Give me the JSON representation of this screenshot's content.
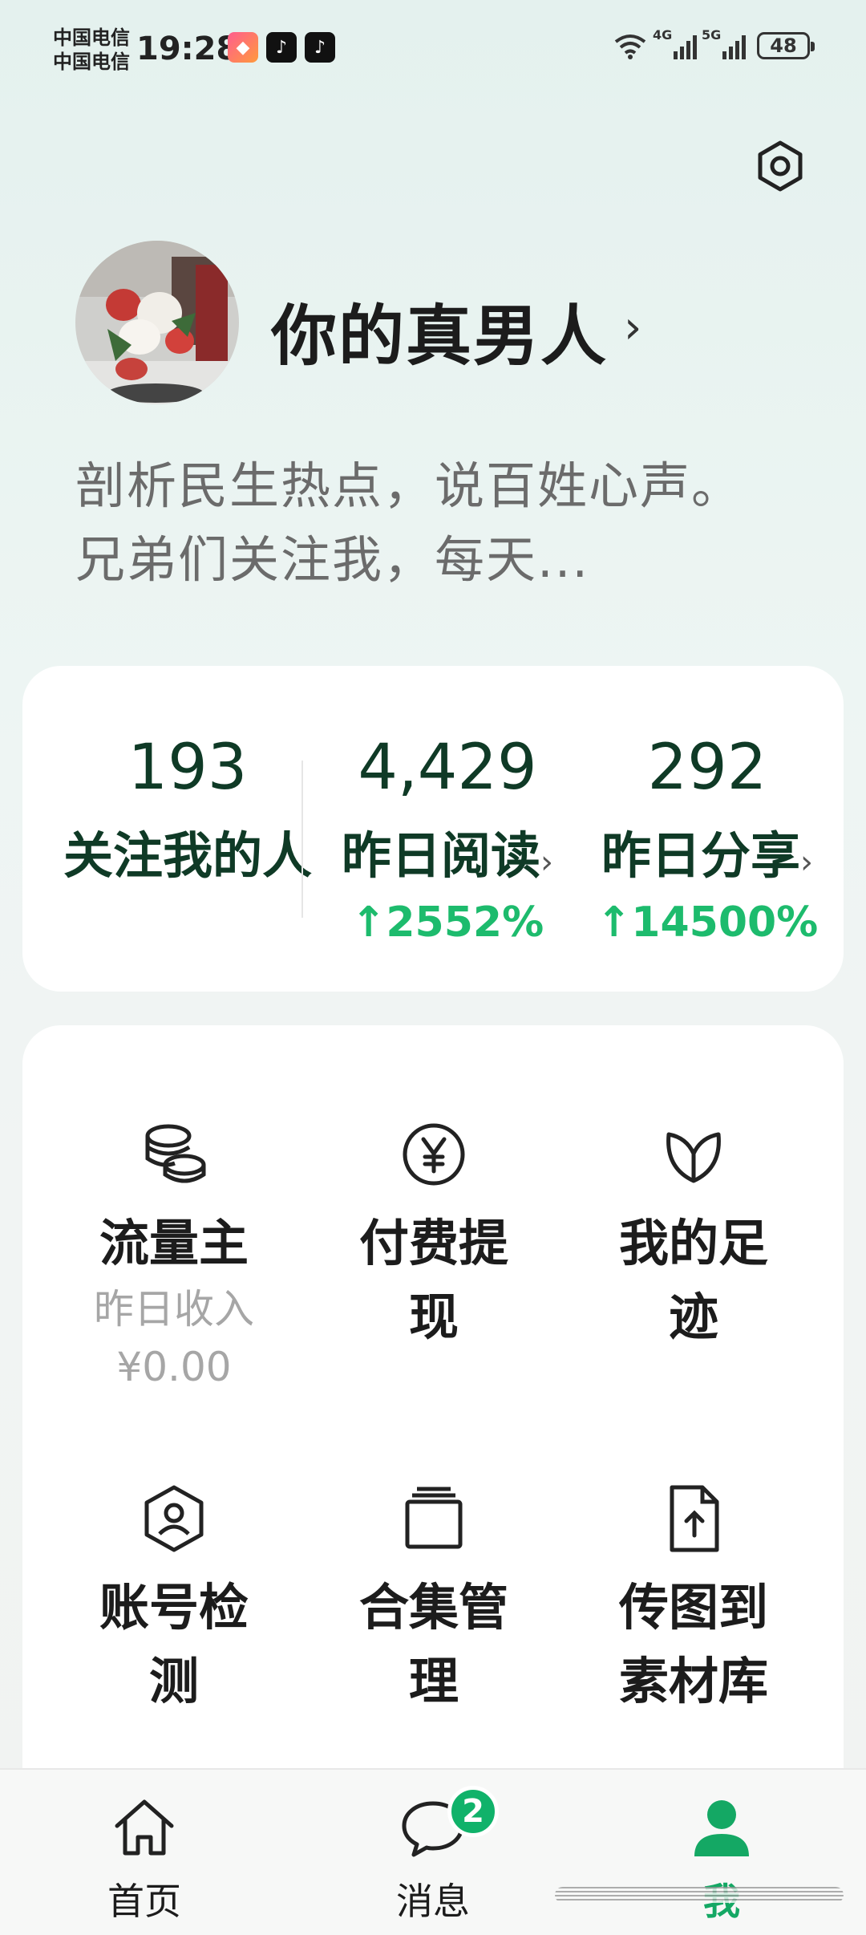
{
  "status_bar": {
    "carrier_1": "中国电信",
    "carrier_2": "中国电信",
    "time": "19:28",
    "network_1": "4G",
    "network_2": "5G",
    "battery": "48"
  },
  "profile": {
    "username": "你的真男人",
    "bio": "剖析民生热点，说百姓心声。兄弟们关注我，每天..."
  },
  "stats": [
    {
      "value": "193",
      "label": "关注我的人",
      "change": ""
    },
    {
      "value": "4,429",
      "label": "昨日阅读",
      "change": "↑2552%"
    },
    {
      "value": "292",
      "label": "昨日分享",
      "change": "↑14500%"
    }
  ],
  "tools": [
    {
      "label": "流量主",
      "sub_label": "昨日收入",
      "sub_value": "¥0.00",
      "icon": "coins-icon"
    },
    {
      "label": "付费提现",
      "icon": "yuan-circle-icon"
    },
    {
      "label": "我的足迹",
      "icon": "leaf-icon"
    },
    {
      "label": "账号检测",
      "icon": "user-shield-icon"
    },
    {
      "label": "合集管理",
      "icon": "collection-icon"
    },
    {
      "label": "传图到素材库",
      "icon": "file-upload-icon"
    }
  ],
  "nav": {
    "home": "首页",
    "messages": "消息",
    "messages_badge": "2",
    "me": "我"
  },
  "colors": {
    "accent": "#1dbb6d",
    "dark_green": "#0f3a26",
    "badge": "#10b26a"
  }
}
